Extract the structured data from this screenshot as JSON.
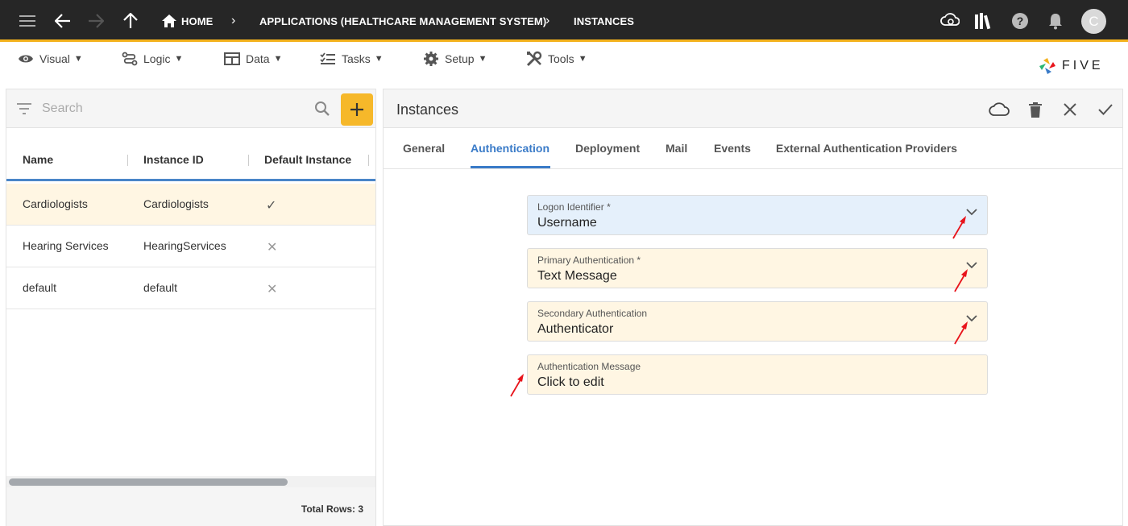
{
  "topbar": {
    "breadcrumbs": [
      "HOME",
      "APPLICATIONS (HEALTHCARE MANAGEMENT SYSTEM)",
      "INSTANCES"
    ],
    "avatar_initial": "C"
  },
  "menu": [
    {
      "label": "Visual",
      "icon": "eye-icon"
    },
    {
      "label": "Logic",
      "icon": "logic-icon"
    },
    {
      "label": "Data",
      "icon": "table-icon"
    },
    {
      "label": "Tasks",
      "icon": "checklist-icon"
    },
    {
      "label": "Setup",
      "icon": "gear-icon"
    },
    {
      "label": "Tools",
      "icon": "tools-icon"
    }
  ],
  "caret": "▼",
  "logo": {
    "text": "FIVE"
  },
  "list": {
    "search_placeholder": "Search",
    "columns": [
      "Name",
      "Instance ID",
      "Default Instance"
    ],
    "rows": [
      {
        "name": "Cardiologists",
        "id": "Cardiologists",
        "default": "✓"
      },
      {
        "name": "Hearing Services",
        "id": "HearingServices",
        "default": "✕"
      },
      {
        "name": "default",
        "id": "default",
        "default": "✕"
      }
    ],
    "total_rows": "Total Rows: 3"
  },
  "form": {
    "title": "Instances",
    "tabs": [
      "General",
      "Authentication",
      "Deployment",
      "Mail",
      "Events",
      "External Authentication Providers"
    ],
    "active_tab": "Authentication",
    "fields": [
      {
        "label": "Logon Identifier *",
        "value": "Username"
      },
      {
        "label": "Primary Authentication *",
        "value": "Text Message"
      },
      {
        "label": "Secondary Authentication",
        "value": "Authenticator"
      },
      {
        "label": "Authentication Message",
        "value": "Click to edit"
      }
    ]
  },
  "colors": {
    "topbar_bg": "#262626",
    "accent": "#f3b11c",
    "tab_active": "#3a7bc8",
    "field_bg": "#fff6e3",
    "field_focus_bg": "#e5f0fb",
    "annotation_arrow": "#e8141b"
  }
}
